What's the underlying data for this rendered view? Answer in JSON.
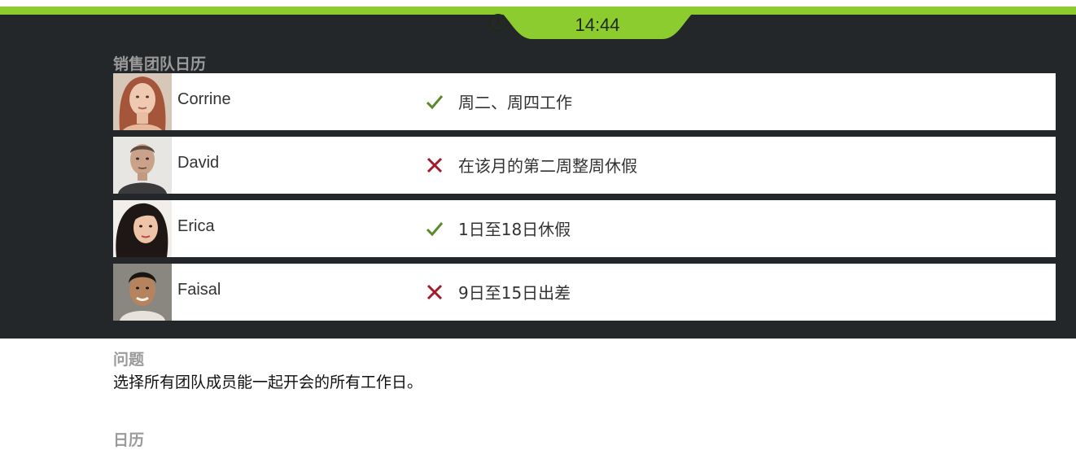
{
  "timer": {
    "icon": "clock-icon",
    "time": "14:44"
  },
  "calendar_section": {
    "title": "销售团队日历",
    "members": [
      {
        "name": "Corrine",
        "status": "check",
        "note": "周二、周四工作"
      },
      {
        "name": "David",
        "status": "cross",
        "note": "在该月的第二周整周休假"
      },
      {
        "name": "Erica",
        "status": "check",
        "note": "1日至18日休假"
      },
      {
        "name": "Faisal",
        "status": "cross",
        "note": "9日至15日出差"
      }
    ]
  },
  "question": {
    "title": "问题",
    "text": "选择所有团队成员能一起开会的所有工作日。"
  },
  "calendar": {
    "title": "日历"
  },
  "colors": {
    "accent_green": "#8ccc2e",
    "dark_panel": "#24272a",
    "check_color": "#5a8a2a",
    "cross_color": "#a31b2a"
  }
}
